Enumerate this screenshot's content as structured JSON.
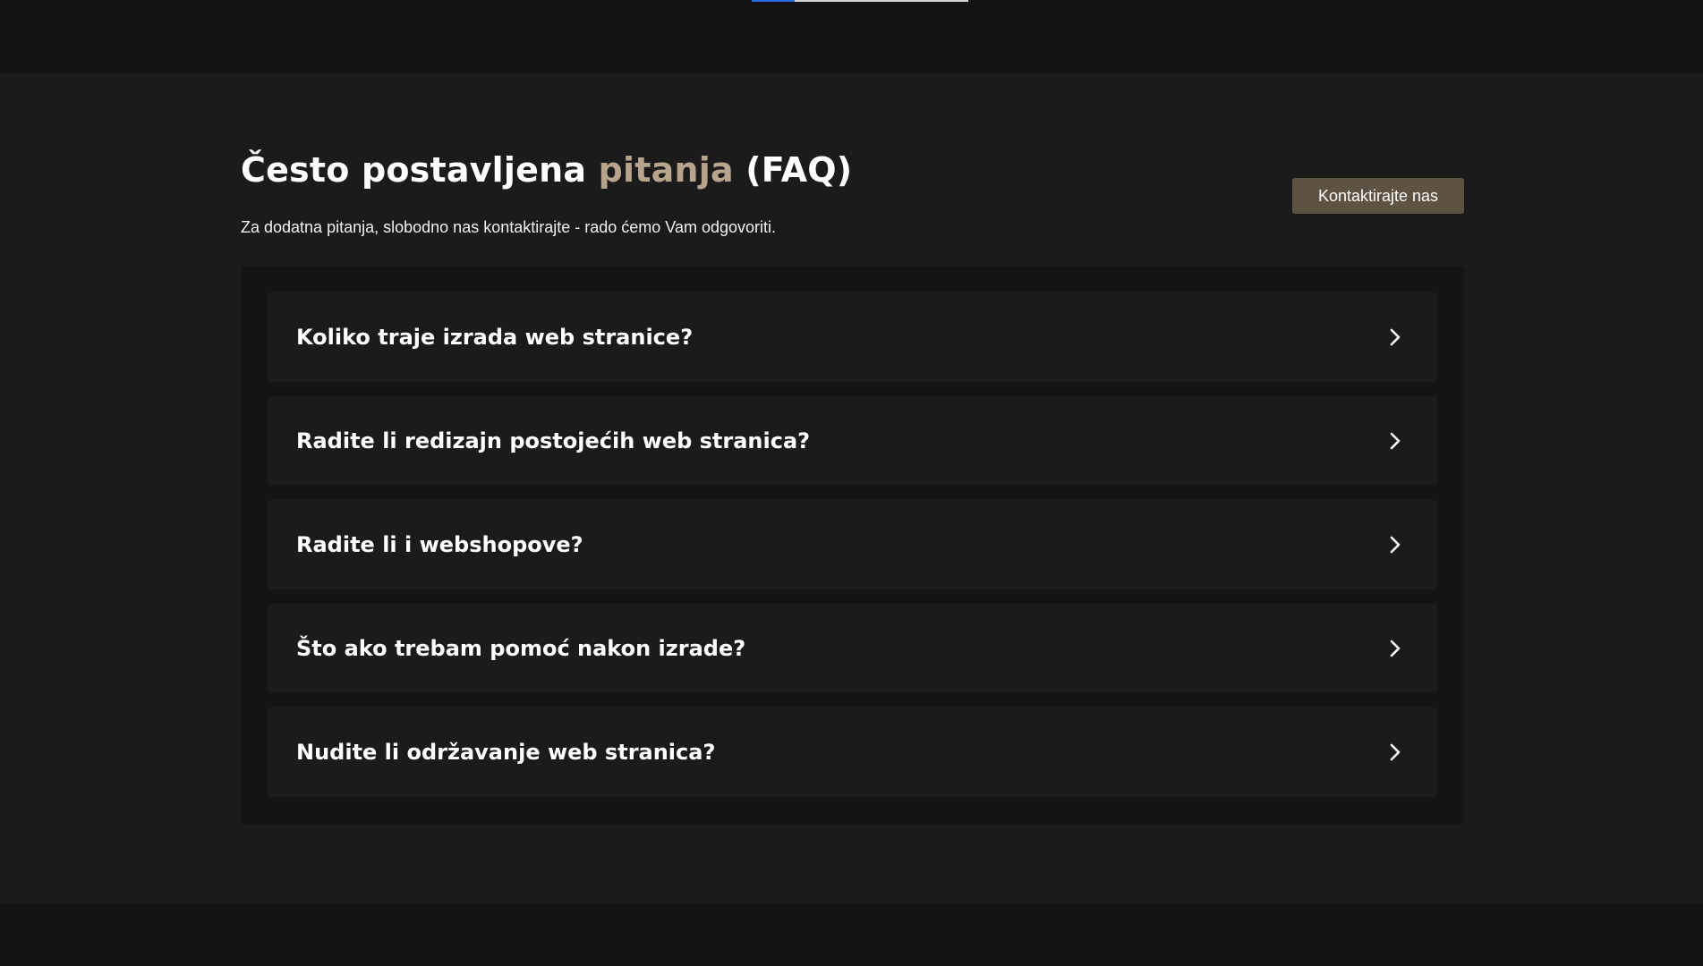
{
  "top": {
    "progress_fraction": 0.2
  },
  "faq": {
    "title_part1": "Često postavljena ",
    "title_accent": "pitanja",
    "title_part2": " (FAQ)",
    "subtitle": "Za dodatna pitanja, slobodno nas kontaktirajte - rado ćemo Vam odgovoriti.",
    "contact_label": "Kontaktirajte nas",
    "items": [
      {
        "question": "Koliko traje izrada web stranice?",
        "icon": "chevron-right-icon"
      },
      {
        "question": "Radite li redizajn postojećih web stranica?",
        "icon": "chevron-right-icon"
      },
      {
        "question": "Radite li i webshopove?",
        "icon": "chevron-right-icon"
      },
      {
        "question": "Što ako trebam pomoć nakon izrade?",
        "icon": "chevron-right-icon"
      },
      {
        "question": "Nudite li održavanje web stranica?",
        "icon": "chevron-right-icon"
      }
    ]
  },
  "colors": {
    "background": "#1b1b1b",
    "panel": "#141414",
    "accent_text": "#b8a48c",
    "button": "#5e5243",
    "progress_fill": "#2a6ae0"
  }
}
